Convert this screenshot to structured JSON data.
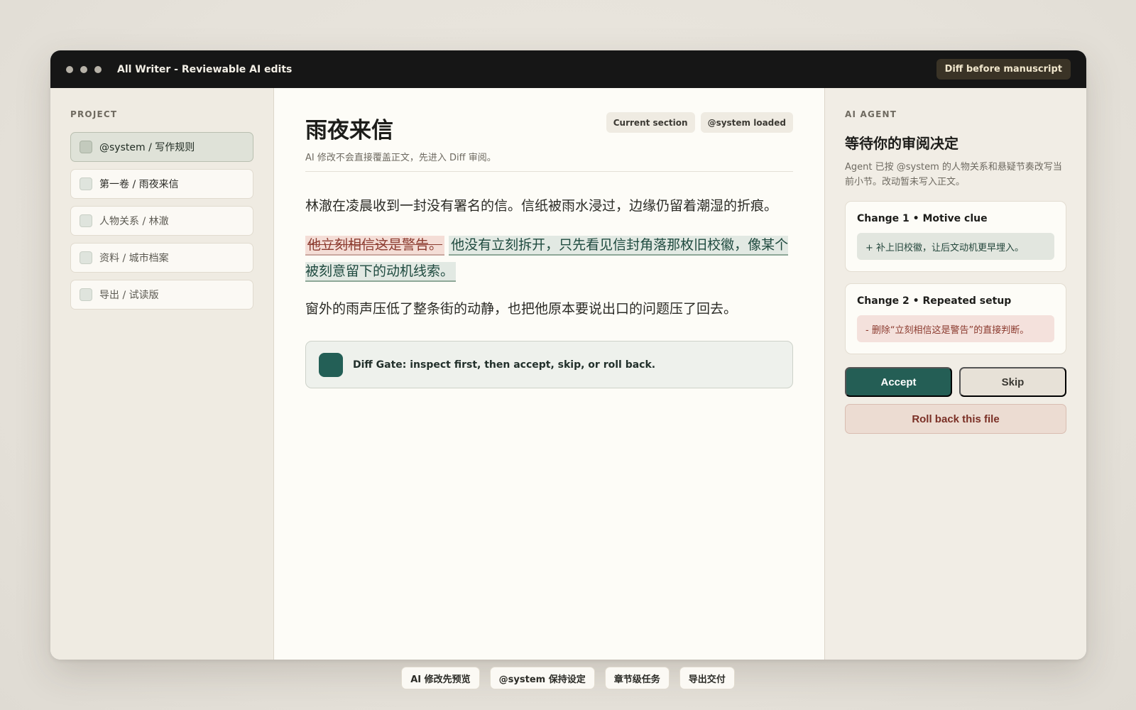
{
  "titlebar": {
    "title": "All Writer - Reviewable AI edits",
    "badge": "Diff before manuscript"
  },
  "sidebar": {
    "label": "PROJECT",
    "items": [
      {
        "label": "@system / 写作规则",
        "active": true
      },
      {
        "label": "第一卷 / 雨夜来信",
        "active": false
      },
      {
        "label": "人物关系 / 林澈",
        "active": false
      },
      {
        "label": "资料 / 城市档案",
        "active": false
      },
      {
        "label": "导出 / 试读版",
        "active": false
      }
    ]
  },
  "editor": {
    "title": "雨夜来信",
    "subtitle": "AI 修改不会直接覆盖正文，先进入 Diff 审阅。",
    "chips": [
      "Current section",
      "@system loaded"
    ],
    "para1": "林澈在凌晨收到一封没有署名的信。信纸被雨水浸过，边缘仍留着潮湿的折痕。",
    "para2_deleted": "他立刻相信这是警告。",
    "para2_inserted": "他没有立刻拆开，只先看见信封角落那枚旧校徽，像某个被刻意留下的动机线索。",
    "para3": "窗外的雨声压低了整条街的动静，也把他原本要说出口的问题压了回去。",
    "gate_text": "Diff Gate: inspect first, then accept, skip, or roll back."
  },
  "agent": {
    "label": "AI AGENT",
    "title": "等待你的审阅决定",
    "description": "Agent 已按 @system 的人物关系和悬疑节奏改写当前小节。改动暂未写入正文。",
    "changes": [
      {
        "head": "Change 1  •  Motive clue",
        "body": "+ 补上旧校徽，让后文动机更早埋入。",
        "kind": "add"
      },
      {
        "head": "Change 2  •  Repeated setup",
        "body": "- 删除“立刻相信这是警告”的直接判断。",
        "kind": "remove"
      }
    ],
    "accept_label": "Accept",
    "skip_label": "Skip",
    "rollback_label": "Roll back this file"
  },
  "footer_tags": [
    "AI 修改先预览",
    "@system 保持设定",
    "章节级任务",
    "导出交付"
  ],
  "colors": {
    "accent": "#245e55",
    "deleted_bg": "#f4ddd6",
    "inserted_bg": "#e2e9e3",
    "titlebar_bg": "#161616"
  }
}
